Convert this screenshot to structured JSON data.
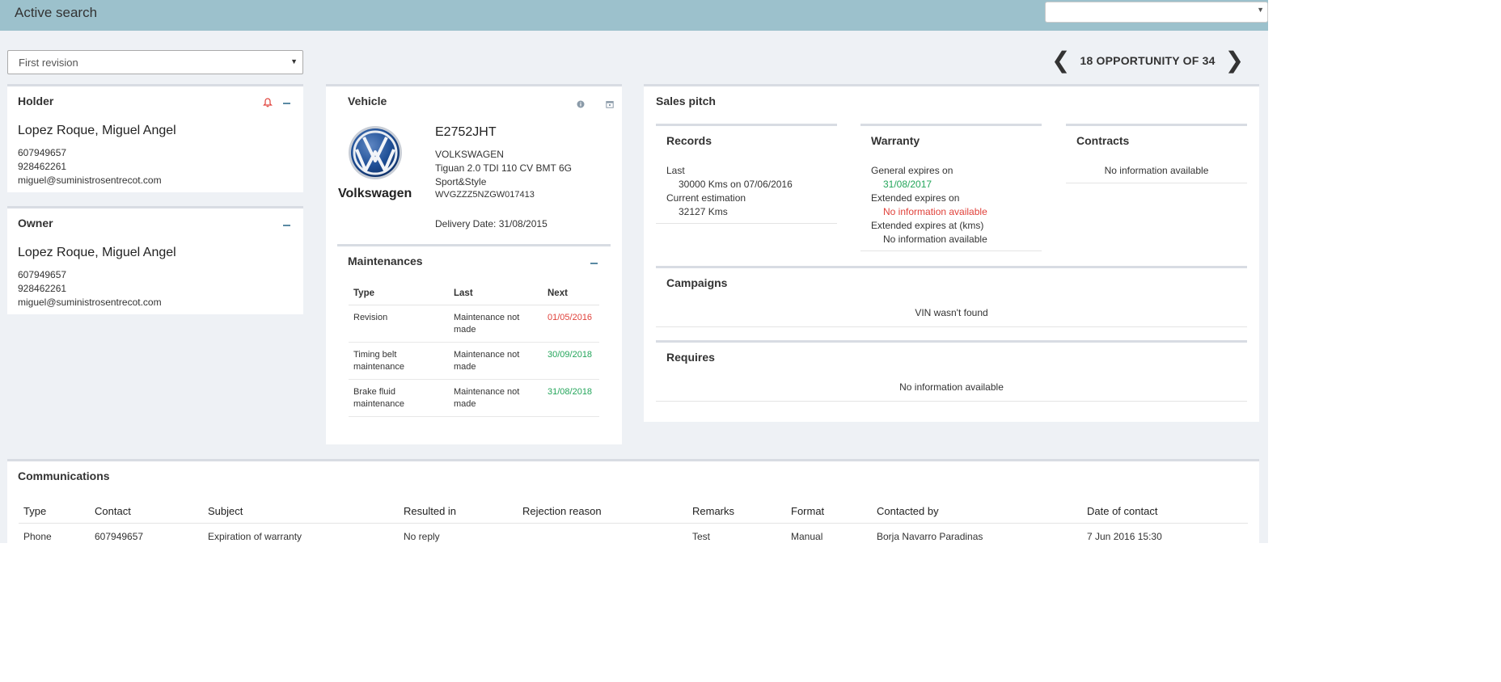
{
  "header": {
    "title": "Active search",
    "top_select_value": ""
  },
  "revision_select": {
    "value": "First revision"
  },
  "pager": {
    "prev_icon": "chevron-left-icon",
    "label": "18 OPPORTUNITY OF 34",
    "next_icon": "chevron-right-icon"
  },
  "holder": {
    "title": "Holder",
    "name": "Lopez Roque, Miguel Angel",
    "phone1": "607949657",
    "phone2": "928462261",
    "email": "miguel@suministrosentrecot.com"
  },
  "owner": {
    "title": "Owner",
    "name": "Lopez Roque, Miguel Angel",
    "phone1": "607949657",
    "phone2": "928462261",
    "email": "miguel@suministrosentrecot.com"
  },
  "vehicle": {
    "title": "Vehicle",
    "brand": "Volkswagen",
    "plate": "E2752JHT",
    "make": "VOLKSWAGEN",
    "model": "Tiguan 2.0 TDI 110 CV BMT 6G",
    "trim": "Sport&Style",
    "vin": "WVGZZZ5NZGW017413",
    "delivery": "Delivery Date: 31/08/2015"
  },
  "maintenances": {
    "title": "Maintenances",
    "headers": [
      "Type",
      "Last",
      "Next"
    ],
    "rows": [
      {
        "type": "Revision",
        "last": "Maintenance not made",
        "next": "01/05/2016",
        "status": "overdue"
      },
      {
        "type": "Timing belt maintenance",
        "last": "Maintenance not made",
        "next": "30/09/2018",
        "status": "ok"
      },
      {
        "type": "Brake fluid maintenance",
        "last": "Maintenance not made",
        "next": "31/08/2018",
        "status": "ok"
      }
    ]
  },
  "sales_pitch": {
    "title": "Sales pitch",
    "records": {
      "title": "Records",
      "last_label": "Last",
      "last_value": "30000 Kms on 07/06/2016",
      "estimation_label": "Current estimation",
      "estimation_value": "32127 Kms"
    },
    "warranty": {
      "title": "Warranty",
      "general_label": "General expires on",
      "general_value": "31/08/2017",
      "extended_label": "Extended expires on",
      "extended_value": "No information available",
      "extended_kms_label": "Extended expires at (kms)",
      "extended_kms_value": "No information available"
    },
    "contracts": {
      "title": "Contracts",
      "value": "No information available"
    },
    "campaigns": {
      "title": "Campaigns",
      "value": "VIN wasn't found"
    },
    "requires": {
      "title": "Requires",
      "value": "No information available"
    }
  },
  "communications": {
    "title": "Communications",
    "headers": [
      "Type",
      "Contact",
      "Subject",
      "Resulted in",
      "Rejection reason",
      "Remarks",
      "Format",
      "Contacted by",
      "Date of contact"
    ],
    "rows": [
      [
        "Phone",
        "607949657",
        "Expiration of warranty",
        "No reply",
        "",
        "Test",
        "Manual",
        "Borja Navarro Paradinas",
        "7 Jun 2016 15:30"
      ]
    ]
  },
  "colors": {
    "topbar": "#9cc1cc",
    "background": "#eef1f5",
    "overdue": "#e0413a",
    "ok": "#23a55a",
    "accent": "#5a8aa3"
  }
}
